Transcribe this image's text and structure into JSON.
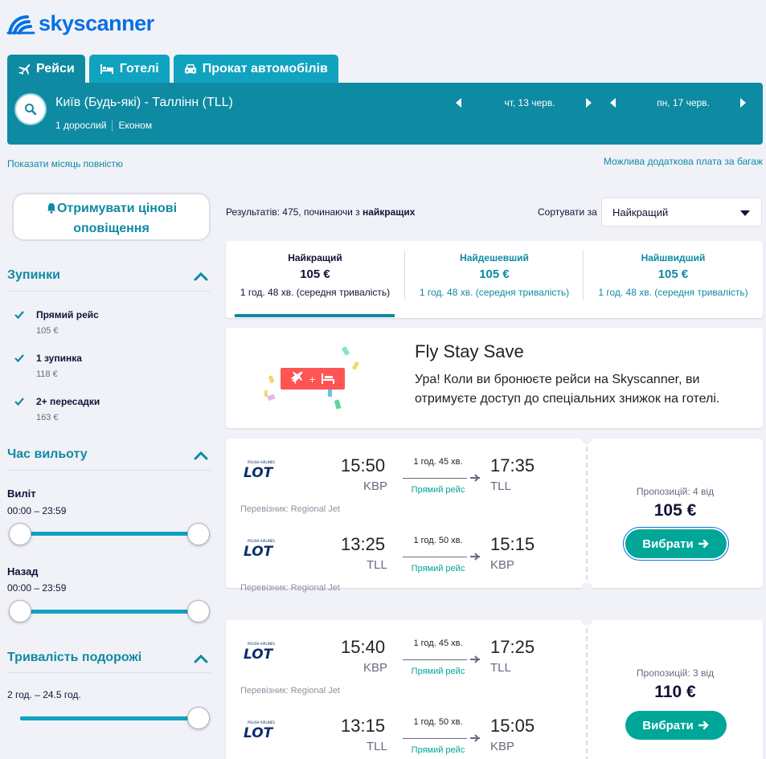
{
  "brand": {
    "name": "skyscanner",
    "color": "#0770e3",
    "accent": "#0e8aa3",
    "cta": "#00a698"
  },
  "tabs": [
    {
      "label": "Рейси",
      "icon": "plane-icon",
      "active": true
    },
    {
      "label": "Готелі",
      "icon": "bed-icon",
      "active": false
    },
    {
      "label": "Прокат автомобілів",
      "icon": "car-icon",
      "active": false
    }
  ],
  "search": {
    "route": "Київ (Будь-які) - Таллінн (TLL)",
    "passengers": "1 дорослий",
    "cabin": "Економ",
    "depart_date": "чт, 13 черв.",
    "return_date": "пн, 17 черв."
  },
  "links": {
    "month_view": "Показати місяць повністю",
    "baggage": "Можлива додаткова плата за багаж"
  },
  "sidebar": {
    "price_alerts": "Отримувати цінові оповіщення",
    "stops": {
      "title": "Зупинки",
      "options": [
        {
          "label": "Прямий рейс",
          "price": "105 €",
          "checked": true
        },
        {
          "label": "1 зупинка",
          "price": "118 €",
          "checked": true
        },
        {
          "label": "2+ пересадки",
          "price": "163 €",
          "checked": true
        }
      ]
    },
    "departure_time": {
      "title": "Час вильоту",
      "outbound_label": "Виліт",
      "outbound_range": "00:00 – 23:59",
      "return_label": "Назад",
      "return_range": "00:00 – 23:59"
    },
    "duration": {
      "title": "Тривалість подорожі",
      "range": "2 год. – 24.5 год."
    }
  },
  "results": {
    "count_prefix": "Результатів: 475, починаючи з ",
    "count_bold": "найкращих",
    "sort_label": "Сортувати за",
    "sort_value": "Найкращий"
  },
  "sort_tabs": [
    {
      "title": "Найкращий",
      "price": "105 €",
      "duration": "1 год. 48 хв. (середня тривалість)"
    },
    {
      "title": "Найдешевший",
      "price": "105 €",
      "duration": "1 год. 48 хв. (середня тривалість)"
    },
    {
      "title": "Найшвидший",
      "price": "105 €",
      "duration": "1 год. 48 хв. (середня тривалість)"
    }
  ],
  "promo": {
    "title": "Fly Stay Save",
    "text": "Ура! Коли ви бронюєте рейси на Skyscanner, ви отримуєте доступ до спеціальних знижок на готелі."
  },
  "flights": [
    {
      "legs": [
        {
          "dep_time": "15:50",
          "dep_airport": "KBP",
          "duration": "1 год. 45 хв.",
          "stops": "Прямий рейс",
          "arr_time": "17:35",
          "arr_airport": "TLL",
          "carrier": "Перевізник: Regional Jet"
        },
        {
          "dep_time": "13:25",
          "dep_airport": "TLL",
          "duration": "1 год. 50 хв.",
          "stops": "Прямий рейс",
          "arr_time": "15:15",
          "arr_airport": "KBP",
          "carrier": "Перевізник: Regional Jet"
        }
      ],
      "offers": "Пропозицій: 4 від",
      "price": "105 €",
      "select": "Вибрати"
    },
    {
      "legs": [
        {
          "dep_time": "15:40",
          "dep_airport": "KBP",
          "duration": "1 год. 45 хв.",
          "stops": "Прямий рейс",
          "arr_time": "17:25",
          "arr_airport": "TLL",
          "carrier": "Перевізник: Regional Jet"
        },
        {
          "dep_time": "13:15",
          "dep_airport": "TLL",
          "duration": "1 год. 50 хв.",
          "stops": "Прямий рейс",
          "arr_time": "15:05",
          "arr_airport": "KBP",
          "carrier": ""
        }
      ],
      "offers": "Пропозицій: 3 від",
      "price": "110 €",
      "select": "Вибрати"
    }
  ]
}
